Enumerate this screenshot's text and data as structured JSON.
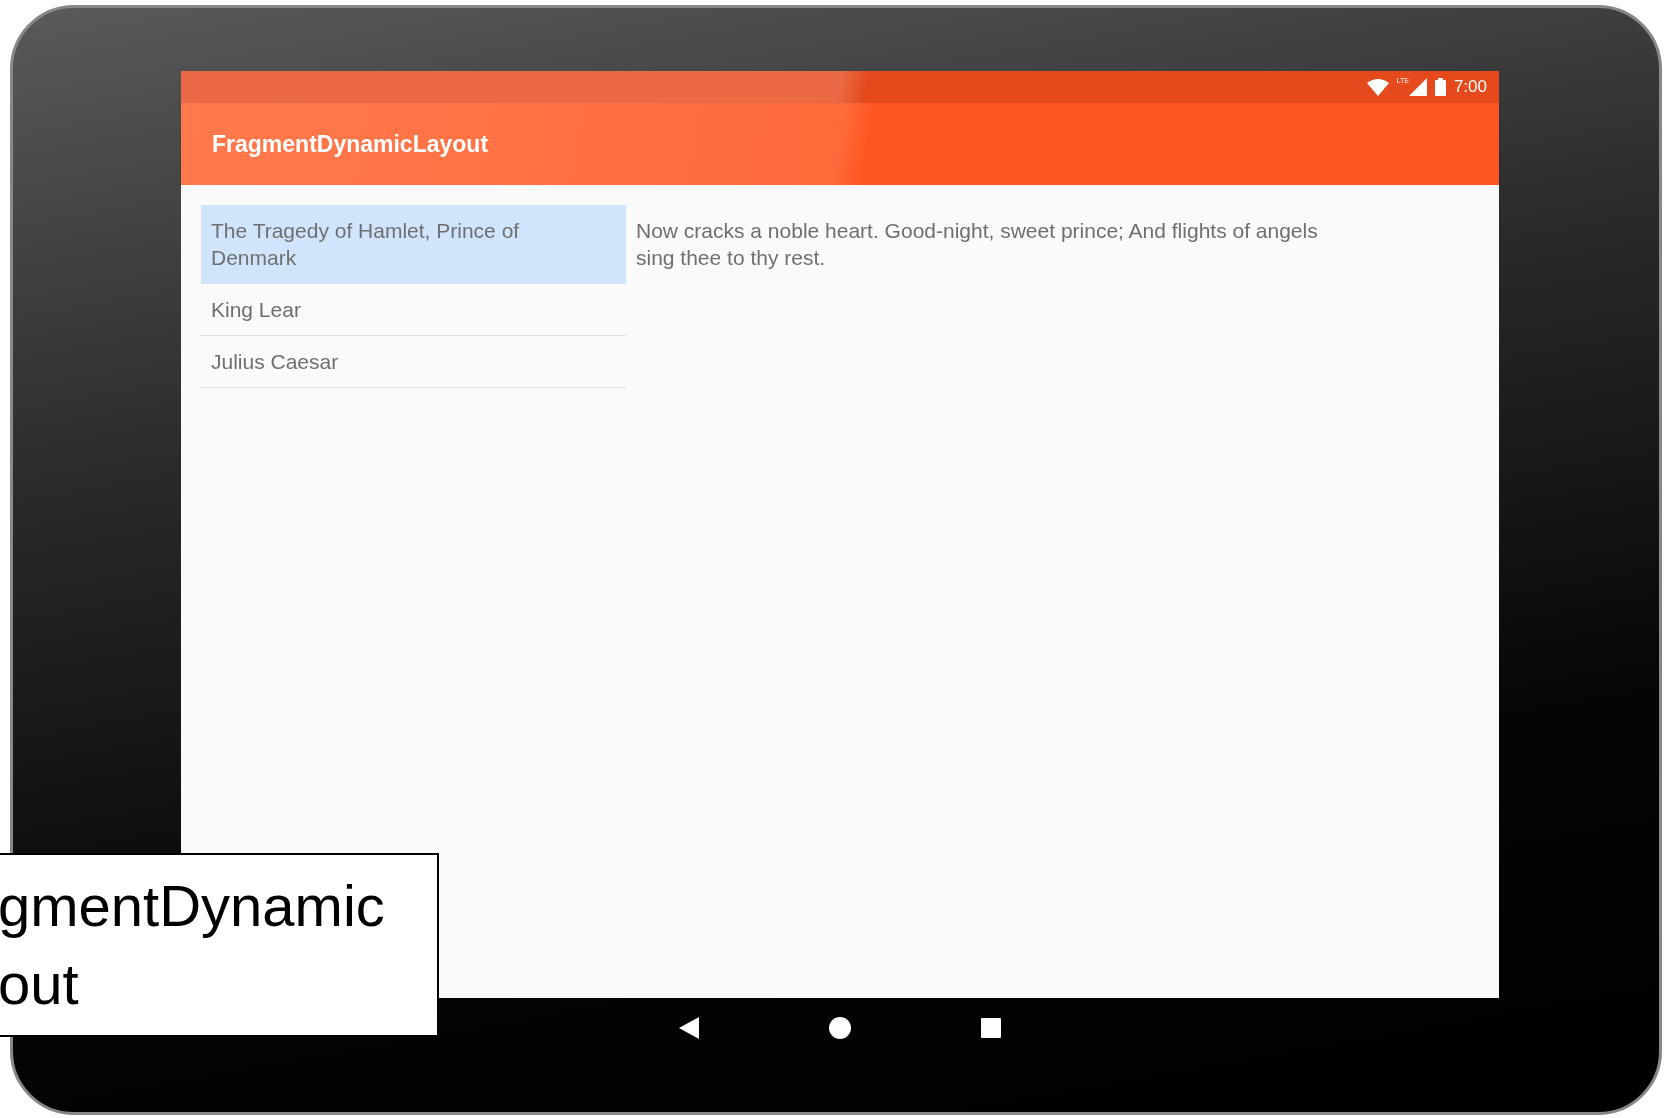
{
  "status_bar": {
    "network": "LTE",
    "time": "7:00"
  },
  "app_bar": {
    "title": "FragmentDynamicLayout"
  },
  "list": [
    {
      "label": "The Tragedy of Hamlet, Prince of Denmark",
      "selected": true
    },
    {
      "label": "King Lear",
      "selected": false
    },
    {
      "label": "Julius Caesar",
      "selected": false
    }
  ],
  "detail": {
    "text": "Now cracks a noble heart. Good-night, sweet prince; And flights of angels sing thee to thy rest."
  },
  "caption": {
    "lines": [
      "gmentDynamic",
      "out"
    ]
  }
}
